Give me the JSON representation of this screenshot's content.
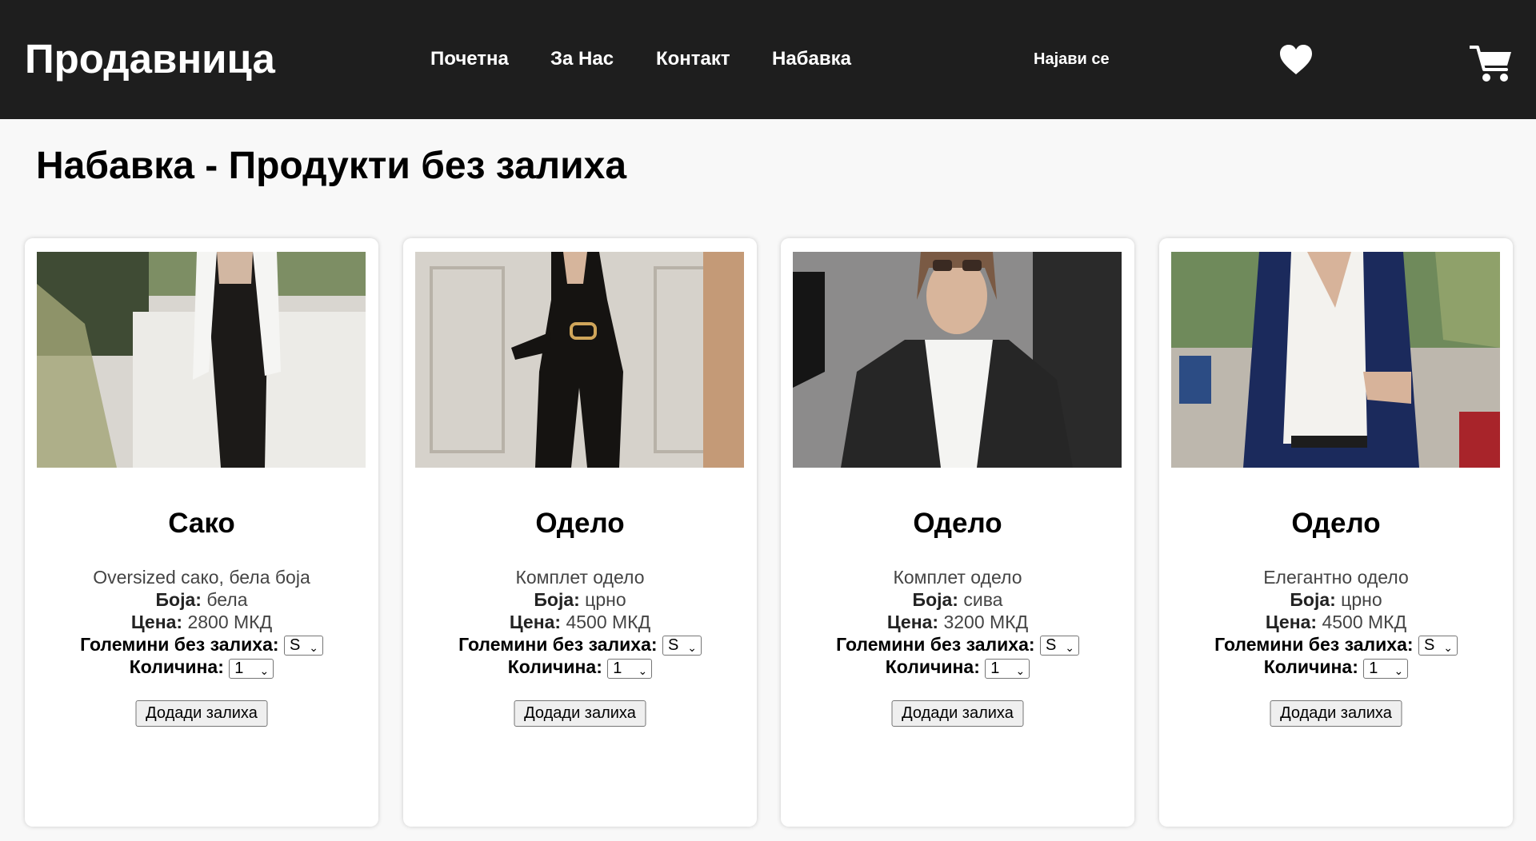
{
  "header": {
    "logo": "Продавница",
    "nav": [
      "Почетна",
      "За Нас",
      "Контакт",
      "Набавка"
    ],
    "login": "Најави се",
    "wishlist_icon": "heart-icon",
    "cart_icon": "cart-icon",
    "background": "#1e1e1e"
  },
  "page": {
    "title": "Набавка - Продукти без залиха"
  },
  "labels": {
    "color": "Боја:",
    "price": "Цена:",
    "sizes_out": "Големини без залиха:",
    "quantity": "Количина:"
  },
  "products": [
    {
      "name": "Сако",
      "description": "Oversized сако, бела боја",
      "color": "бела",
      "price": "2800 МКД",
      "size": "S",
      "quantity": "1",
      "button": "Додади залиха"
    },
    {
      "name": "Одело",
      "description": "Комплет одело",
      "color": "црно",
      "price": "4500 МКД",
      "size": "S",
      "quantity": "1",
      "button": "Додади залиха"
    },
    {
      "name": "Одело",
      "description": "Комплет одело",
      "color": "сива",
      "price": "3200 МКД",
      "size": "S",
      "quantity": "1",
      "button": "Додади залиха"
    },
    {
      "name": "Одело",
      "description": "Елегантно одело",
      "color": "црно",
      "price": "4500 МКД",
      "size": "S",
      "quantity": "1",
      "button": "Додади залиха"
    }
  ]
}
